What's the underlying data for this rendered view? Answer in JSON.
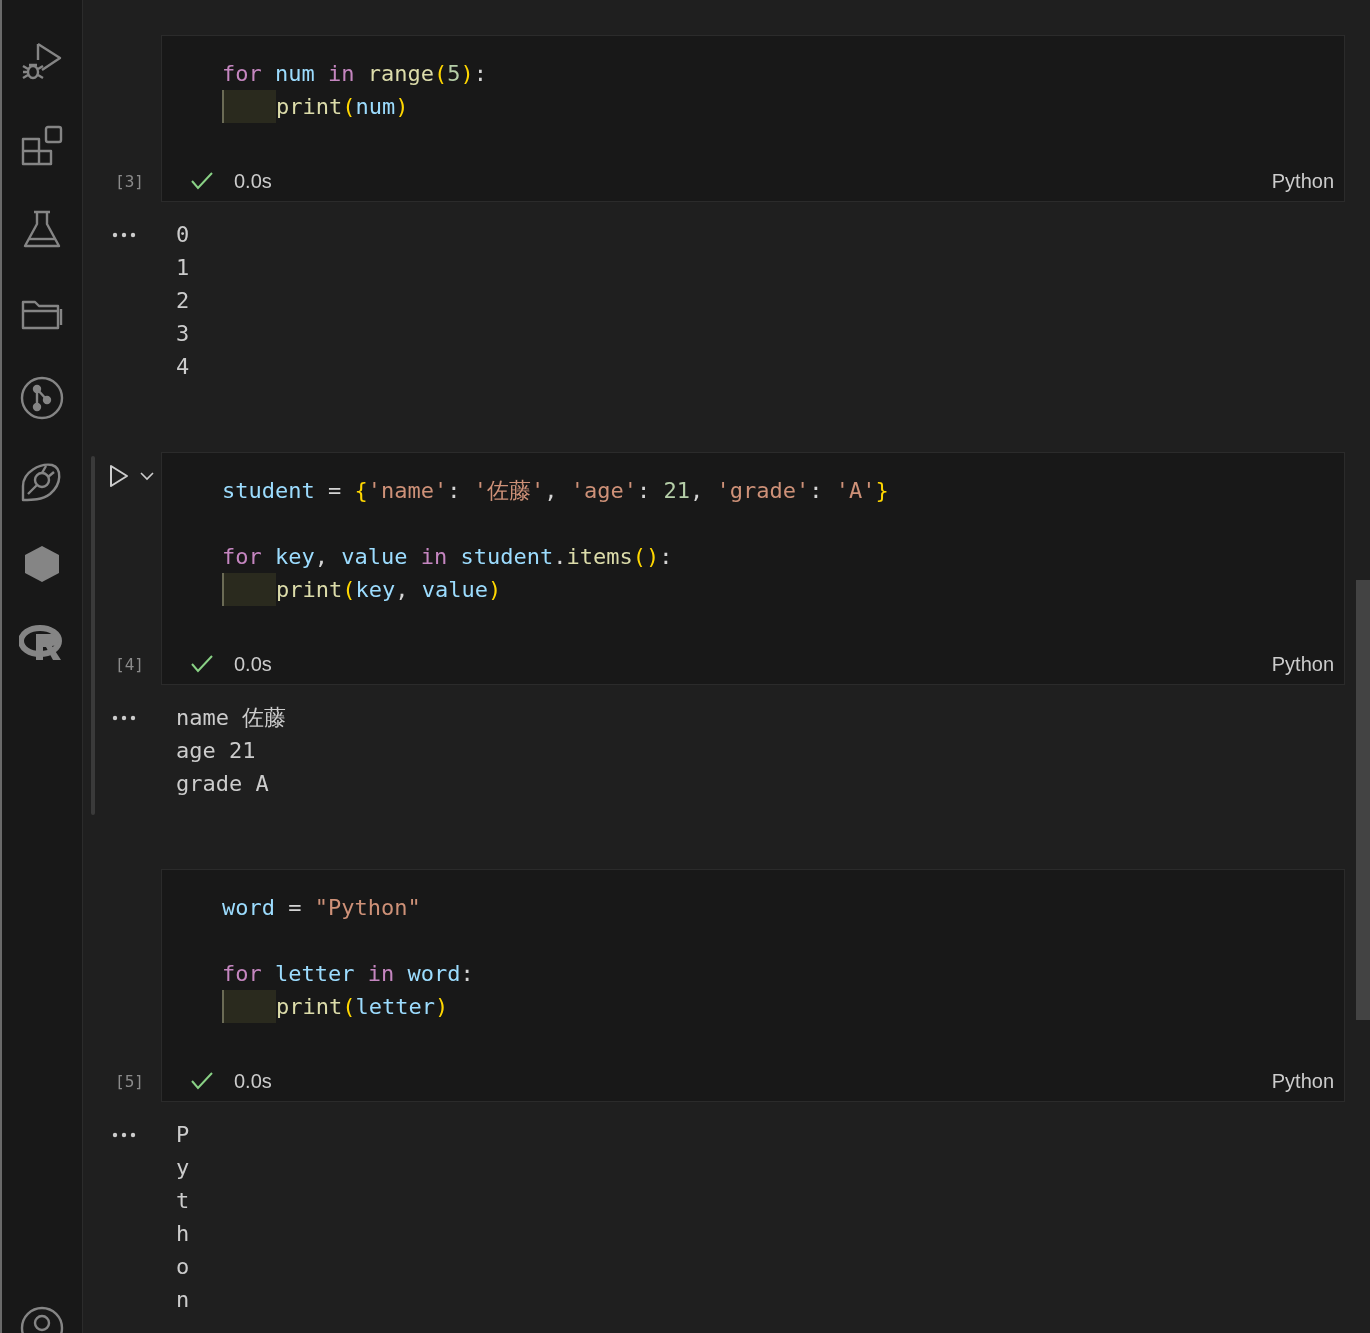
{
  "cells": [
    {
      "selected": false,
      "execution_count": "[3]",
      "status": "0.0s",
      "succeeded": true,
      "language": "Python",
      "code": [
        {
          "indent": false,
          "tokens": [
            {
              "kind": "keyword",
              "text": "for "
            },
            {
              "kind": "variable",
              "text": "num "
            },
            {
              "kind": "keyword",
              "text": "in "
            },
            {
              "kind": "function",
              "text": "range"
            },
            {
              "kind": "bracket",
              "text": "("
            },
            {
              "kind": "number",
              "text": "5"
            },
            {
              "kind": "bracket",
              "text": ")"
            },
            {
              "kind": "plain",
              "text": ":"
            }
          ]
        },
        {
          "indent": true,
          "tokens": [
            {
              "kind": "function",
              "text": "print"
            },
            {
              "kind": "bracket",
              "text": "("
            },
            {
              "kind": "variable",
              "text": "num"
            },
            {
              "kind": "bracket",
              "text": ")"
            }
          ]
        }
      ],
      "output": [
        "0",
        "1",
        "2",
        "3",
        "4"
      ]
    },
    {
      "selected": true,
      "execution_count": "[4]",
      "status": "0.0s",
      "succeeded": true,
      "language": "Python",
      "code": [
        {
          "indent": false,
          "tokens": [
            {
              "kind": "variable",
              "text": "student"
            },
            {
              "kind": "plain",
              "text": " = "
            },
            {
              "kind": "bracket",
              "text": "{"
            },
            {
              "kind": "string",
              "text": "'name'"
            },
            {
              "kind": "plain",
              "text": ": "
            },
            {
              "kind": "string",
              "text": "'佐藤'"
            },
            {
              "kind": "plain",
              "text": ", "
            },
            {
              "kind": "string",
              "text": "'age'"
            },
            {
              "kind": "plain",
              "text": ": "
            },
            {
              "kind": "number",
              "text": "21"
            },
            {
              "kind": "plain",
              "text": ", "
            },
            {
              "kind": "string",
              "text": "'grade'"
            },
            {
              "kind": "plain",
              "text": ": "
            },
            {
              "kind": "string",
              "text": "'A'"
            },
            {
              "kind": "bracket",
              "text": "}"
            }
          ]
        },
        {
          "indent": false
        },
        {
          "indent": false,
          "tokens": [
            {
              "kind": "keyword",
              "text": "for "
            },
            {
              "kind": "variable",
              "text": "key"
            },
            {
              "kind": "plain",
              "text": ", "
            },
            {
              "kind": "variable",
              "text": "value "
            },
            {
              "kind": "keyword",
              "text": "in "
            },
            {
              "kind": "variable",
              "text": "student"
            },
            {
              "kind": "plain",
              "text": "."
            },
            {
              "kind": "function",
              "text": "items"
            },
            {
              "kind": "bracket",
              "text": "()"
            },
            {
              "kind": "plain",
              "text": ":"
            }
          ]
        },
        {
          "indent": true,
          "tokens": [
            {
              "kind": "function",
              "text": "print"
            },
            {
              "kind": "bracket",
              "text": "("
            },
            {
              "kind": "variable",
              "text": "key"
            },
            {
              "kind": "plain",
              "text": ", "
            },
            {
              "kind": "variable",
              "text": "value"
            },
            {
              "kind": "bracket",
              "text": ")"
            }
          ]
        }
      ],
      "output": [
        "name 佐藤",
        "age 21",
        "grade A"
      ]
    },
    {
      "selected": false,
      "execution_count": "[5]",
      "status": "0.0s",
      "succeeded": true,
      "language": "Python",
      "code": [
        {
          "indent": false,
          "tokens": [
            {
              "kind": "variable",
              "text": "word"
            },
            {
              "kind": "plain",
              "text": " = "
            },
            {
              "kind": "string",
              "text": "\"Python\""
            }
          ]
        },
        {
          "indent": false
        },
        {
          "indent": false,
          "tokens": [
            {
              "kind": "keyword",
              "text": "for "
            },
            {
              "kind": "variable",
              "text": "letter "
            },
            {
              "kind": "keyword",
              "text": "in "
            },
            {
              "kind": "variable",
              "text": "word"
            },
            {
              "kind": "plain",
              "text": ":"
            }
          ]
        },
        {
          "indent": true,
          "tokens": [
            {
              "kind": "function",
              "text": "print"
            },
            {
              "kind": "bracket",
              "text": "("
            },
            {
              "kind": "variable",
              "text": "letter"
            },
            {
              "kind": "bracket",
              "text": ")"
            }
          ]
        }
      ],
      "output": [
        "P",
        "y",
        "t",
        "h",
        "o",
        "n"
      ]
    }
  ]
}
